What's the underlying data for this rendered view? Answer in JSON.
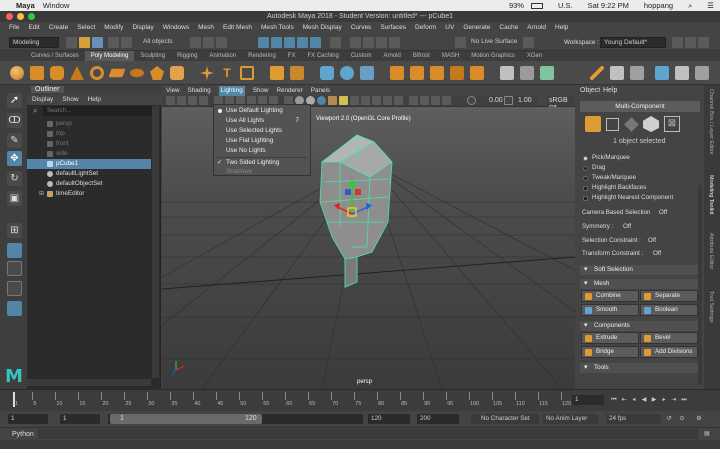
{
  "mac_menubar": {
    "app": "Maya",
    "menu": "Window",
    "battery": "93%",
    "locale": "U.S.",
    "clock": "Sat 9:22 PM",
    "user": "hoppang"
  },
  "window": {
    "title": "Autodesk Maya 2018 - Student Version: untitled*   ---   pCube1"
  },
  "main_menu": [
    "File",
    "Edit",
    "Create",
    "Select",
    "Modify",
    "Display",
    "Windows",
    "Mesh",
    "Edit Mesh",
    "Mesh Tools",
    "Mesh Display",
    "Curves",
    "Surfaces",
    "Deform",
    "UV",
    "Generate",
    "Cache",
    "Arnold",
    "Help"
  ],
  "statusline": {
    "menuset": "Modeling",
    "objects": "All objects",
    "live_surface": "No Live Surface",
    "workspace_label": "Workspace :",
    "workspace": "Young Default*"
  },
  "shelf_tabs": [
    "Curves / Surfaces",
    "Poly Modeling",
    "Sculpting",
    "Rigging",
    "Animation",
    "Rendering",
    "FX",
    "FX Caching",
    "Custom",
    "Arnold",
    "Bifrost",
    "MASH",
    "Motion Graphics",
    "XGen"
  ],
  "shelf_active": "Poly Modeling",
  "outliner": {
    "tab": "Outliner",
    "menu": [
      "Display",
      "Show",
      "Help"
    ],
    "search_placeholder": "Search...",
    "items": [
      {
        "label": "persp",
        "state": "dim"
      },
      {
        "label": "top",
        "state": "dim"
      },
      {
        "label": "front",
        "state": "dim"
      },
      {
        "label": "side",
        "state": "dim"
      },
      {
        "label": "pCube1",
        "state": "selected"
      },
      {
        "label": "defaultLightSet",
        "state": "normal"
      },
      {
        "label": "defaultObjectSet",
        "state": "normal"
      },
      {
        "label": "timeEditor",
        "state": "normal"
      }
    ]
  },
  "viewport": {
    "menu": [
      "View",
      "Shading",
      "Lighting",
      "Show",
      "Renderer",
      "Panels"
    ],
    "active_menu": "Lighting",
    "hud": "Viewport 2.0 (OpenGL Core Profile)",
    "camera": "persp",
    "exposure": "0.00",
    "gamma": "1.00",
    "colorspace": "sRGB ga"
  },
  "lighting_menu": [
    {
      "label": "Use Default Lighting",
      "mark": "bullet",
      "hotkey": ""
    },
    {
      "label": "Use All Lights",
      "mark": "",
      "hotkey": "7"
    },
    {
      "label": "Use Selected Lights",
      "mark": "",
      "hotkey": ""
    },
    {
      "label": "Use Flat Lighting",
      "mark": "",
      "hotkey": ""
    },
    {
      "label": "Use No Lights",
      "mark": "",
      "hotkey": ""
    },
    {
      "label": "Two Sided Lighting",
      "mark": "check",
      "hotkey": ""
    },
    {
      "label": "Shadows",
      "mark": "",
      "hotkey": "",
      "disabled": true
    }
  ],
  "modeling_toolkit": {
    "tabs": [
      "Object",
      "Help"
    ],
    "mode": "Multi-Component",
    "selection_info": "1 object selected",
    "pick_options": [
      "Pick/Marquee",
      "Drag",
      "Tweak/Marquee"
    ],
    "checkboxes": [
      "Highlight Backfaces",
      "Highlight Nearest Component"
    ],
    "camera_based": {
      "label": "Camera Based Selection",
      "value": "Off"
    },
    "symmetry": {
      "label": "Symmetry :",
      "value": "Off"
    },
    "selection_constraint": {
      "label": "Selection Constraint :",
      "value": "Off"
    },
    "transform_constraint": {
      "label": "Transform Constraint :",
      "value": "Off"
    },
    "sections": {
      "soft": "Soft Selection",
      "mesh": "Mesh",
      "components": "Components",
      "tools": "Tools"
    },
    "mesh_buttons": [
      "Combine",
      "Separate",
      "Smooth",
      "Boolean"
    ],
    "component_buttons": [
      "Extrude",
      "Bevel",
      "Bridge",
      "Add Divisions"
    ]
  },
  "side_tabs": [
    "Channel Box / Layer Editor",
    "Modeling Toolkit",
    "Attribute Editor",
    "Tool Settings"
  ],
  "timeline": {
    "ticks": [
      "1",
      "5",
      "10",
      "15",
      "20",
      "25",
      "30",
      "35",
      "40",
      "45",
      "50",
      "55",
      "60",
      "65",
      "70",
      "75",
      "80",
      "85",
      "90",
      "95",
      "100",
      "105",
      "110",
      "115",
      "120"
    ],
    "current_frame": "1"
  },
  "range": {
    "start": "1",
    "anim_start": "1",
    "slider_start": "1",
    "slider_end": "120",
    "end": "120",
    "anim_end": "200",
    "character_set": "No Character Set",
    "anim_layer": "No Anim Layer",
    "fps": "24 fps"
  },
  "command_line": {
    "language": "Python"
  },
  "colors": {
    "selection_blue": "#5285a6",
    "accent_orange": "#e09a32",
    "wire_green": "#4ee3a0"
  }
}
